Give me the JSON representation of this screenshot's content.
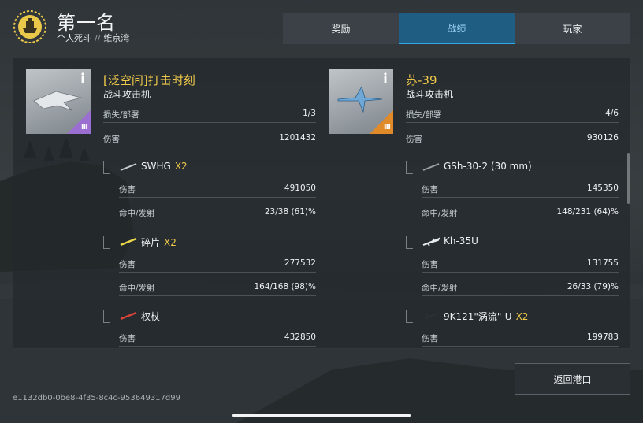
{
  "header": {
    "title": "第一名",
    "mode": "个人死斗",
    "separator": "//",
    "map": "维京湾"
  },
  "tabs": [
    {
      "label": "奖励",
      "active": false
    },
    {
      "label": "战绩",
      "active": true
    },
    {
      "label": "玩家",
      "active": false
    }
  ],
  "vehicles": [
    {
      "name": "[泛空间]打击时刻",
      "class": "战斗攻击机",
      "tier": "III",
      "tier_color": "#9b6fd1",
      "stats": [
        {
          "label": "损失/部署",
          "value": "1/3"
        },
        {
          "label": "伤害",
          "value": "1201432"
        }
      ],
      "weapons": [
        {
          "name": "SWHG",
          "multiplier": "X2",
          "icon": "gun-icon",
          "stats": [
            {
              "label": "伤害",
              "value": "491050"
            },
            {
              "label": "命中/发射",
              "value": "23/38 (61)%"
            }
          ]
        },
        {
          "name": "碎片",
          "multiplier": "X2",
          "icon": "shard-missile-icon",
          "stats": [
            {
              "label": "伤害",
              "value": "277532"
            },
            {
              "label": "命中/发射",
              "value": "164/168 (98)%"
            }
          ]
        },
        {
          "name": "权杖",
          "multiplier": "",
          "icon": "scepter-missile-icon",
          "stats": [
            {
              "label": "伤害",
              "value": "432850"
            }
          ]
        }
      ]
    },
    {
      "name": "苏-39",
      "class": "战斗攻击机",
      "tier": "III",
      "tier_color": "#e08a2a",
      "stats": [
        {
          "label": "损失/部署",
          "value": "4/6"
        },
        {
          "label": "伤害",
          "value": "930126"
        }
      ],
      "weapons": [
        {
          "name": "GSh-30-2 (30 mm)",
          "multiplier": "",
          "icon": "cannon-icon",
          "stats": [
            {
              "label": "伤害",
              "value": "145350"
            },
            {
              "label": "命中/发射",
              "value": "148/231 (64)%"
            }
          ]
        },
        {
          "name": "Kh-35U",
          "multiplier": "",
          "icon": "missile-icon",
          "stats": [
            {
              "label": "伤害",
              "value": "131755"
            },
            {
              "label": "命中/发射",
              "value": "26/33 (79)%"
            }
          ]
        },
        {
          "name": "9K121\"涡流\"-U",
          "multiplier": "X2",
          "icon": "atgm-icon",
          "stats": [
            {
              "label": "伤害",
              "value": "199783"
            }
          ]
        }
      ]
    }
  ],
  "footer": {
    "return_label": "返回港口",
    "session_id": "e1132db0-0be8-4f35-8c4c-953649317d99"
  },
  "colors": {
    "accent_gold": "#f0c94a",
    "tab_active": "#1f5d82",
    "tab_active_border": "#35a7e6"
  }
}
